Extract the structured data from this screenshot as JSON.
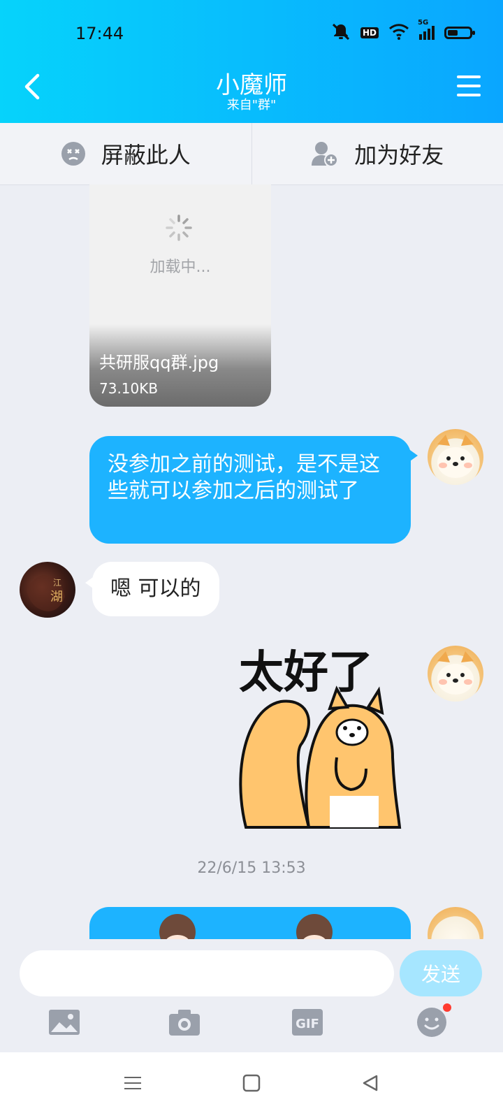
{
  "status": {
    "time": "17:44",
    "hd_label": "HD",
    "network": "5G",
    "icons": [
      "mute-icon",
      "hd-icon",
      "wifi-icon",
      "signal-icon",
      "battery-icon"
    ]
  },
  "header": {
    "title": "小魔师",
    "subtitle": "来自\"群\""
  },
  "actions": {
    "block_label": "屏蔽此人",
    "add_friend_label": "加为好友"
  },
  "messages": {
    "file": {
      "loading_text": "加载中...",
      "filename": "共研服qq群.jpg",
      "size": "73.10KB"
    },
    "question": {
      "text": "没参加之前的测试，是不是这些就可以参加之后的测试了"
    },
    "reply": {
      "text": "嗯 可以的"
    },
    "sticker_caption": "太好了",
    "timestamp": "22/6/15 13:53"
  },
  "input": {
    "placeholder": "",
    "value": "",
    "send_label": "发送"
  },
  "toolbar": {
    "items": [
      "image-icon",
      "camera-icon",
      "gif-icon",
      "emoji-icon"
    ],
    "gif_label": "GIF"
  },
  "colors": {
    "accent": "#1db3ff",
    "header_start": "#06d3fb",
    "header_end": "#0aa6ff",
    "send_disabled": "#a6e6ff",
    "badge": "#ff3b30"
  }
}
